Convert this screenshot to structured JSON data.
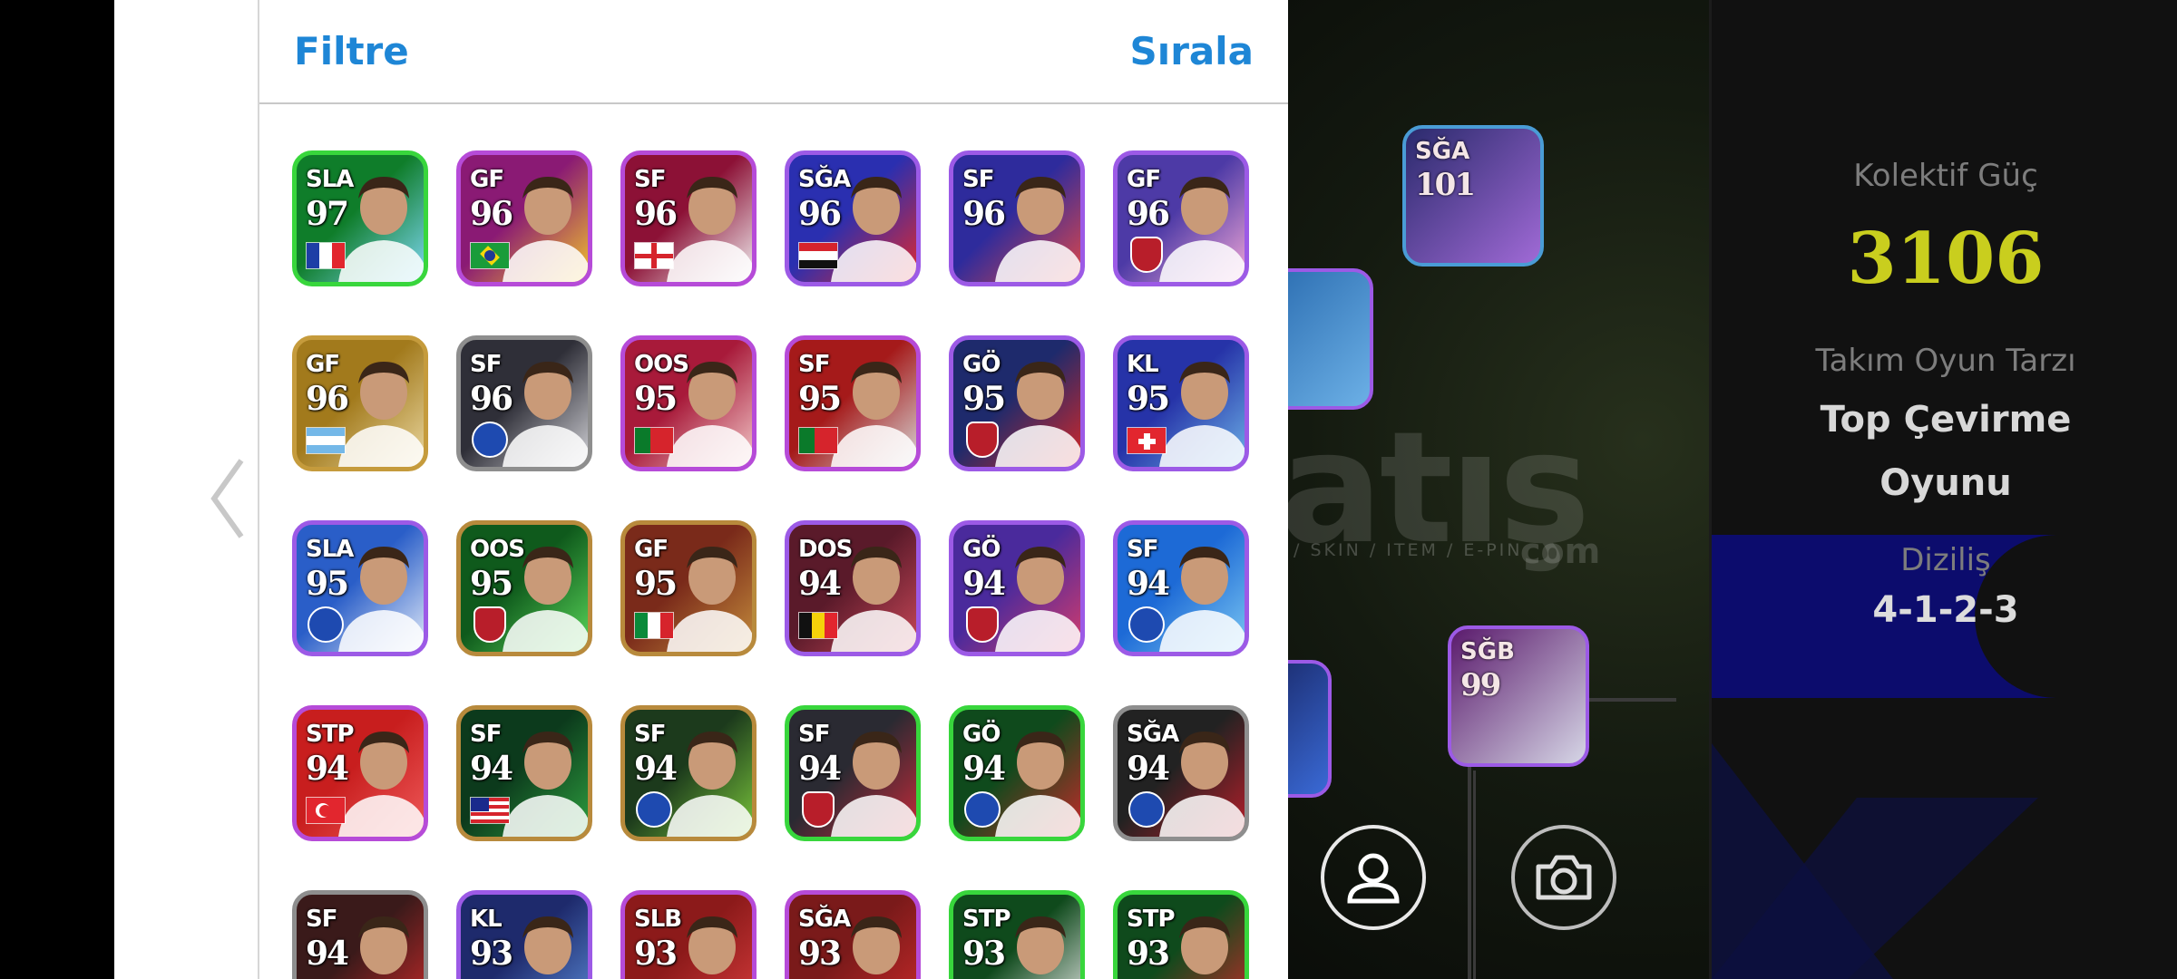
{
  "header": {
    "filter_label": "Filtre",
    "sort_label": "Sırala"
  },
  "cards": [
    {
      "pos": "SLA",
      "rating": "97",
      "colors": [
        "#0f7d2a",
        "#7fd7f5"
      ],
      "border": "#38d63c",
      "flag": "fr"
    },
    {
      "pos": "GF",
      "rating": "96",
      "colors": [
        "#8a1a74",
        "#f2c42c"
      ],
      "border": "#b64bd8",
      "flag": "br"
    },
    {
      "pos": "SF",
      "rating": "96",
      "colors": [
        "#8c1136",
        "#f0eef0"
      ],
      "border": "#b64bd8",
      "flag": "en"
    },
    {
      "pos": "SĞA",
      "rating": "96",
      "colors": [
        "#2a2fb0",
        "#e2292e"
      ],
      "border": "#9c5ae6",
      "flag": "eg"
    },
    {
      "pos": "SF",
      "rating": "96",
      "colors": [
        "#2e2b9c",
        "#e24848"
      ],
      "border": "#9c5ae6",
      "flag": "none"
    },
    {
      "pos": "GF",
      "rating": "96",
      "colors": [
        "#4d3aa6",
        "#f0a6d6"
      ],
      "border": "#9c5ae6",
      "flag": "badge"
    },
    {
      "pos": "GF",
      "rating": "96",
      "colors": [
        "#a27a1c",
        "#ead7a0"
      ],
      "border": "#c59b3c",
      "flag": "ar"
    },
    {
      "pos": "SF",
      "rating": "96",
      "colors": [
        "#2f2f38",
        "#d3d3d8"
      ],
      "border": "#8e8e8e",
      "flag": "badge-round"
    },
    {
      "pos": "OOS",
      "rating": "95",
      "colors": [
        "#a81a3a",
        "#f2c8c8"
      ],
      "border": "#b64bd8",
      "flag": "pt"
    },
    {
      "pos": "SF",
      "rating": "95",
      "colors": [
        "#a51a1a",
        "#d6d6d6"
      ],
      "border": "#b64bd8",
      "flag": "pt"
    },
    {
      "pos": "GÖ",
      "rating": "95",
      "colors": [
        "#1e2a6c",
        "#d62828"
      ],
      "border": "#9c5ae6",
      "flag": "badge"
    },
    {
      "pos": "KL",
      "rating": "95",
      "colors": [
        "#2633a8",
        "#6cb0e6"
      ],
      "border": "#9c5ae6",
      "flag": "ch"
    },
    {
      "pos": "SLA",
      "rating": "95",
      "colors": [
        "#2a5ec8",
        "#e0e9f8"
      ],
      "border": "#9c5ae6",
      "flag": "badge-round"
    },
    {
      "pos": "OOS",
      "rating": "95",
      "colors": [
        "#0f5a1c",
        "#5ad65a"
      ],
      "border": "#b88a3c",
      "flag": "badge"
    },
    {
      "pos": "GF",
      "rating": "95",
      "colors": [
        "#7a2a1a",
        "#c48c3c"
      ],
      "border": "#b88a3c",
      "flag": "it"
    },
    {
      "pos": "DOS",
      "rating": "94",
      "colors": [
        "#5a1a2a",
        "#c84858"
      ],
      "border": "#9c5ae6",
      "flag": "be"
    },
    {
      "pos": "GÖ",
      "rating": "94",
      "colors": [
        "#4a2a9c",
        "#d63c6c"
      ],
      "border": "#9c5ae6",
      "flag": "badge"
    },
    {
      "pos": "SF",
      "rating": "94",
      "colors": [
        "#1d6ad6",
        "#7ac6f2"
      ],
      "border": "#9c5ae6",
      "flag": "badge-round"
    },
    {
      "pos": "STP",
      "rating": "94",
      "colors": [
        "#c81e1e",
        "#ef5a5a"
      ],
      "border": "#b64bd8",
      "flag": "tr"
    },
    {
      "pos": "SF",
      "rating": "94",
      "colors": [
        "#0c3a1c",
        "#2ea040"
      ],
      "border": "#b88a3c",
      "flag": "my"
    },
    {
      "pos": "SF",
      "rating": "94",
      "colors": [
        "#1c3a1c",
        "#7ac63c"
      ],
      "border": "#b88a3c",
      "flag": "badge-round"
    },
    {
      "pos": "SF",
      "rating": "94",
      "colors": [
        "#2a2a32",
        "#c82a3a"
      ],
      "border": "#38d63c",
      "flag": "badge"
    },
    {
      "pos": "GÖ",
      "rating": "94",
      "colors": [
        "#0f4a1c",
        "#c82a2a"
      ],
      "border": "#38d63c",
      "flag": "badge-round"
    },
    {
      "pos": "SĞA",
      "rating": "94",
      "colors": [
        "#222",
        "#b81e2a"
      ],
      "border": "#8e8e8e",
      "flag": "badge-round"
    },
    {
      "pos": "SF",
      "rating": "94",
      "colors": [
        "#3a1a1a",
        "#c82a2a"
      ],
      "border": "#8e8e8e",
      "flag": "none"
    },
    {
      "pos": "KL",
      "rating": "93",
      "colors": [
        "#1e2a6c",
        "#5a8ad6"
      ],
      "border": "#9c5ae6",
      "flag": "none"
    },
    {
      "pos": "SLB",
      "rating": "93",
      "colors": [
        "#8c1a1a",
        "#d63c3c"
      ],
      "border": "#b64bd8",
      "flag": "none"
    },
    {
      "pos": "SĞA",
      "rating": "93",
      "colors": [
        "#7a1a1a",
        "#c82a2a"
      ],
      "border": "#b64bd8",
      "flag": "none"
    },
    {
      "pos": "STP",
      "rating": "93",
      "colors": [
        "#0f4a1c",
        "#e8e8e8"
      ],
      "border": "#38d63c",
      "flag": "none"
    },
    {
      "pos": "STP",
      "rating": "93",
      "colors": [
        "#0f4a1c",
        "#c82a2a"
      ],
      "border": "#38d63c",
      "flag": "none"
    }
  ],
  "field": {
    "watermark": "atış",
    "watermark_sub": "/ SKIN / ITEM / E-PIN",
    "watermark_com": "com",
    "players": [
      {
        "pos": "SĞA",
        "rating": "101",
        "border": "#4a9cd6",
        "colors": [
          "#2a2a6c",
          "#a06ad6"
        ]
      },
      {
        "pos": "",
        "rating": "",
        "border": "#9c5ae6",
        "colors": [
          "#2a6cb0",
          "#6cb0e6"
        ]
      },
      {
        "pos": "SĞB",
        "rating": "99",
        "border": "#9c5ae6",
        "colors": [
          "#5a1a6c",
          "#d6d6e6"
        ]
      },
      {
        "pos": "",
        "rating": "",
        "border": "#9c5ae6",
        "colors": [
          "#1a2a6c",
          "#3a6ad6"
        ]
      }
    ]
  },
  "stats": {
    "power_label": "Kolektif Güç",
    "power_value": "3106",
    "style_label": "Takım Oyun Tarzı",
    "style_value": "Top Çevirme Oyunu",
    "formation_label": "Diziliş",
    "formation_value": "4-1-2-3"
  },
  "icons": {
    "back": "chevron-left-icon",
    "profile": "user-icon",
    "camera": "camera-icon"
  }
}
